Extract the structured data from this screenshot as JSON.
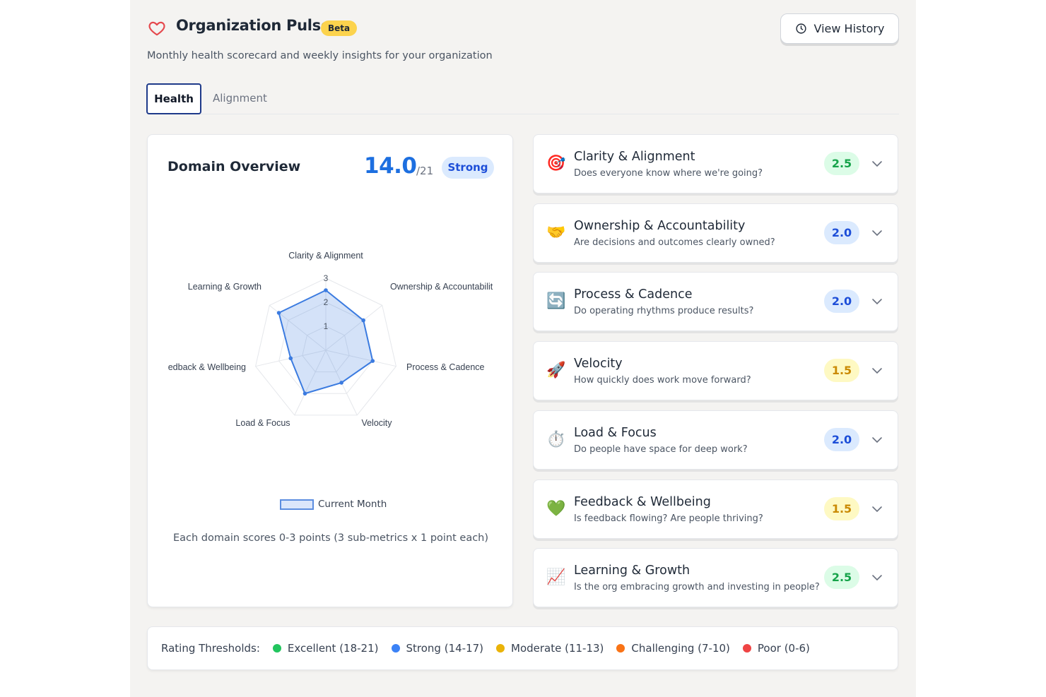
{
  "header": {
    "title": "Organization Pulse",
    "beta_label": "Beta",
    "subtitle": "Monthly health scorecard and weekly insights for your organization",
    "history_button": "View History",
    "icon": "heart-icon",
    "accent_color": "#e5484d"
  },
  "tabs": [
    {
      "label": "Health",
      "active": true
    },
    {
      "label": "Alignment",
      "active": false
    }
  ],
  "overview": {
    "title": "Domain Overview",
    "score": "14.0",
    "max": "/21",
    "rating": "Strong",
    "legend_label": "Current Month",
    "note": "Each domain scores 0-3 points (3 sub-metrics x 1 point each)"
  },
  "chart_data": {
    "type": "radar",
    "axes": [
      "Clarity & Alignment",
      "Ownership & Accountability",
      "Process & Cadence",
      "Velocity",
      "Load & Focus",
      "Feedback & Wellbeing",
      "Learning & Growth"
    ],
    "axes_displayed": [
      "Clarity & Alignment",
      "Ownership & Accountabilit",
      "Process & Cadence",
      "Velocity",
      "Load & Focus",
      "edback & Wellbeing",
      "Learning & Growth"
    ],
    "rlim": [
      0,
      3
    ],
    "ticks": [
      "1",
      "2",
      "3"
    ],
    "series": [
      {
        "name": "Current Month",
        "values": [
          2.5,
          2.0,
          2.0,
          1.5,
          2.0,
          1.5,
          2.5
        ],
        "color": "#3b7be0"
      }
    ]
  },
  "domains": [
    {
      "name": "Clarity & Alignment",
      "question": "Does everyone know where we're going?",
      "score": "2.5",
      "icon": "target-icon",
      "emoji": "🎯",
      "level": "excellent"
    },
    {
      "name": "Ownership & Accountability",
      "question": "Are decisions and outcomes clearly owned?",
      "score": "2.0",
      "icon": "handshake-icon",
      "emoji": "🤝",
      "level": "strong"
    },
    {
      "name": "Process & Cadence",
      "question": "Do operating rhythms produce results?",
      "score": "2.0",
      "icon": "cycle-icon",
      "emoji": "🔄",
      "level": "strong"
    },
    {
      "name": "Velocity",
      "question": "How quickly does work move forward?",
      "score": "1.5",
      "icon": "rocket-icon",
      "emoji": "🚀",
      "level": "moderate"
    },
    {
      "name": "Load & Focus",
      "question": "Do people have space for deep work?",
      "score": "2.0",
      "icon": "stopwatch-icon",
      "emoji": "⏱️",
      "level": "strong"
    },
    {
      "name": "Feedback & Wellbeing",
      "question": "Is feedback flowing? Are people thriving?",
      "score": "1.5",
      "icon": "green-heart-icon",
      "emoji": "💚",
      "level": "moderate"
    },
    {
      "name": "Learning & Growth",
      "question": "Is the org embracing growth and investing in people?",
      "score": "2.5",
      "icon": "chart-increasing-icon",
      "emoji": "📈",
      "level": "excellent"
    }
  ],
  "score_styles": {
    "excellent": {
      "bg": "#dcfce7",
      "fg": "#16a34a"
    },
    "strong": {
      "bg": "#dbeafe",
      "fg": "#1d4ed8"
    },
    "moderate": {
      "bg": "#fef9c3",
      "fg": "#ca8a04"
    }
  },
  "thresholds": {
    "label": "Rating Thresholds:",
    "items": [
      {
        "label": "Excellent (18-21)",
        "color": "#22c55e"
      },
      {
        "label": "Strong (14-17)",
        "color": "#3b82f6"
      },
      {
        "label": "Moderate (11-13)",
        "color": "#eab308"
      },
      {
        "label": "Challenging (7-10)",
        "color": "#f97316"
      },
      {
        "label": "Poor (0-6)",
        "color": "#ef4444"
      }
    ]
  }
}
